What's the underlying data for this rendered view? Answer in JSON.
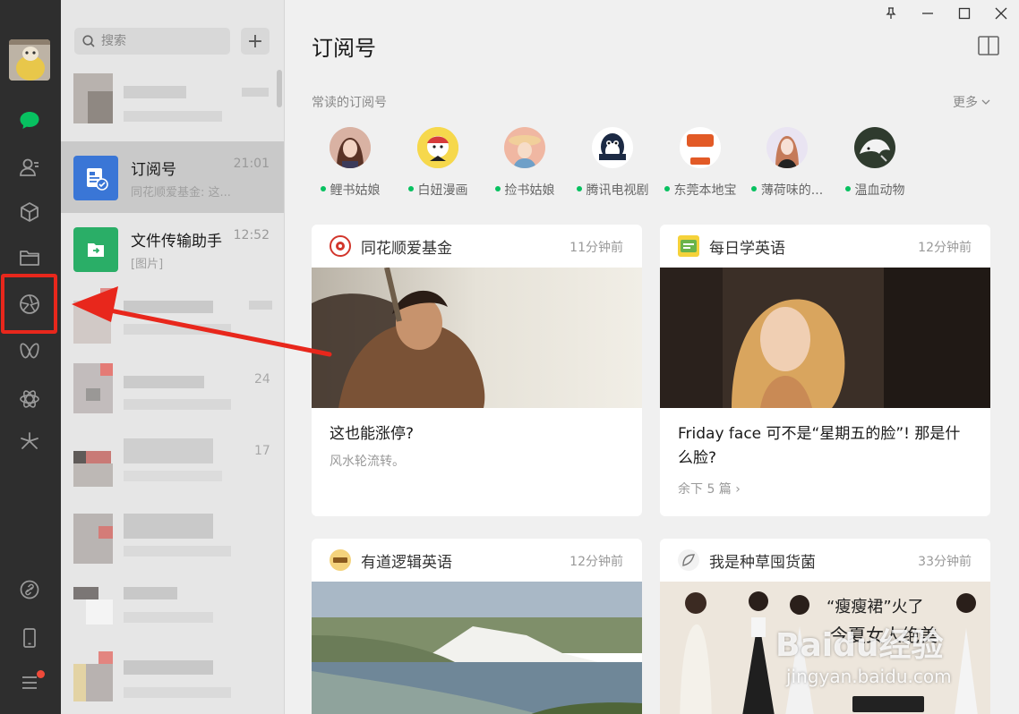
{
  "rail": {
    "avatar": "user-avatar",
    "icons": [
      "chat-bubble-icon",
      "contacts-icon",
      "favorites-cube-icon",
      "folder-icon",
      "moments-aperture-icon",
      "channels-butterfly-icon",
      "discover-atom-icon",
      "miniprogram-sparkle-icon",
      "link-icon",
      "phone-icon",
      "menu-icon"
    ],
    "accent": "#07c160",
    "highlight_color": "#e8271c"
  },
  "search": {
    "placeholder": "搜索"
  },
  "add_label": "+",
  "chats": [
    {
      "name": "订阅号",
      "time": "21:01",
      "preview": "同花顺爱基金: 这...",
      "icon": "subscription-icon",
      "active": true
    },
    {
      "name": "文件传输助手",
      "time": "12:52",
      "preview": "[图片]",
      "icon": "file-transfer-icon",
      "active": false
    }
  ],
  "blurred_times": [
    "24",
    "17"
  ],
  "main": {
    "title": "订阅号",
    "frequent_label": "常读的订阅号",
    "more_label": "更多",
    "accounts": [
      {
        "name": "鲤书姑娘"
      },
      {
        "name": "白妞漫画"
      },
      {
        "name": "捡书姑娘"
      },
      {
        "name": "腾讯电视剧"
      },
      {
        "name": "东莞本地宝"
      },
      {
        "name": "薄荷味的..."
      },
      {
        "name": "温血动物"
      }
    ],
    "cards": [
      {
        "source": "同花顺爱基金",
        "time": "11分钟前",
        "headline": "这也能涨停?",
        "sub": "风水轮流转。",
        "remain": ""
      },
      {
        "source": "每日学英语",
        "time": "12分钟前",
        "headline": "Friday face 可不是“星期五的脸”! 那是什么脸?",
        "sub": "",
        "remain": "余下 5 篇 ›"
      },
      {
        "source": "有道逻辑英语",
        "time": "12分钟前",
        "headline": "",
        "sub": "",
        "remain": ""
      },
      {
        "source": "我是种草囤货菌",
        "time": "33分钟前",
        "headline": "",
        "sub": "",
        "remain": ""
      }
    ],
    "image_overlay_text": [
      "“瘦瘦裙”火了",
      "今夏女人绝美"
    ]
  },
  "watermark": {
    "line1": "Baidu经验",
    "line2": "jingyan.baidu.com"
  }
}
